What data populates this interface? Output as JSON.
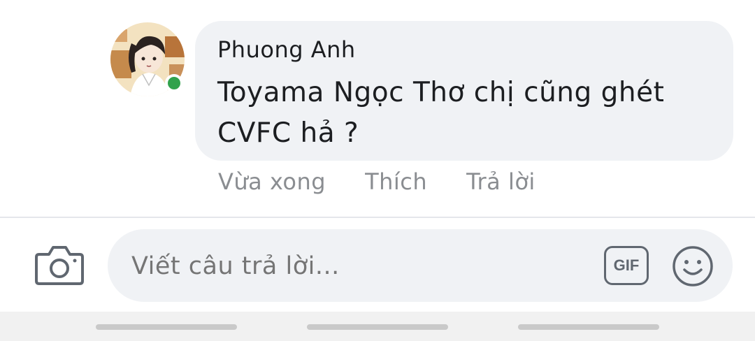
{
  "comment": {
    "author": "Phuong Anh",
    "text": "Toyama Ngọc Thơ chị cũng ghét CVFC hả ?",
    "online": true,
    "avatar_icon": "user-avatar-illustration",
    "online_color": "#31a24c"
  },
  "actions": {
    "timestamp": "Vừa xong",
    "like_label": "Thích",
    "reply_label": "Trả lời"
  },
  "composer": {
    "placeholder": "Viết câu trả lời...",
    "camera_icon": "camera-icon",
    "gif_label": "GIF",
    "emoji_icon": "smiley-icon"
  },
  "colors": {
    "bubble": "#f0f2f5",
    "text": "#1c1e21",
    "muted": "#8a8d91"
  }
}
